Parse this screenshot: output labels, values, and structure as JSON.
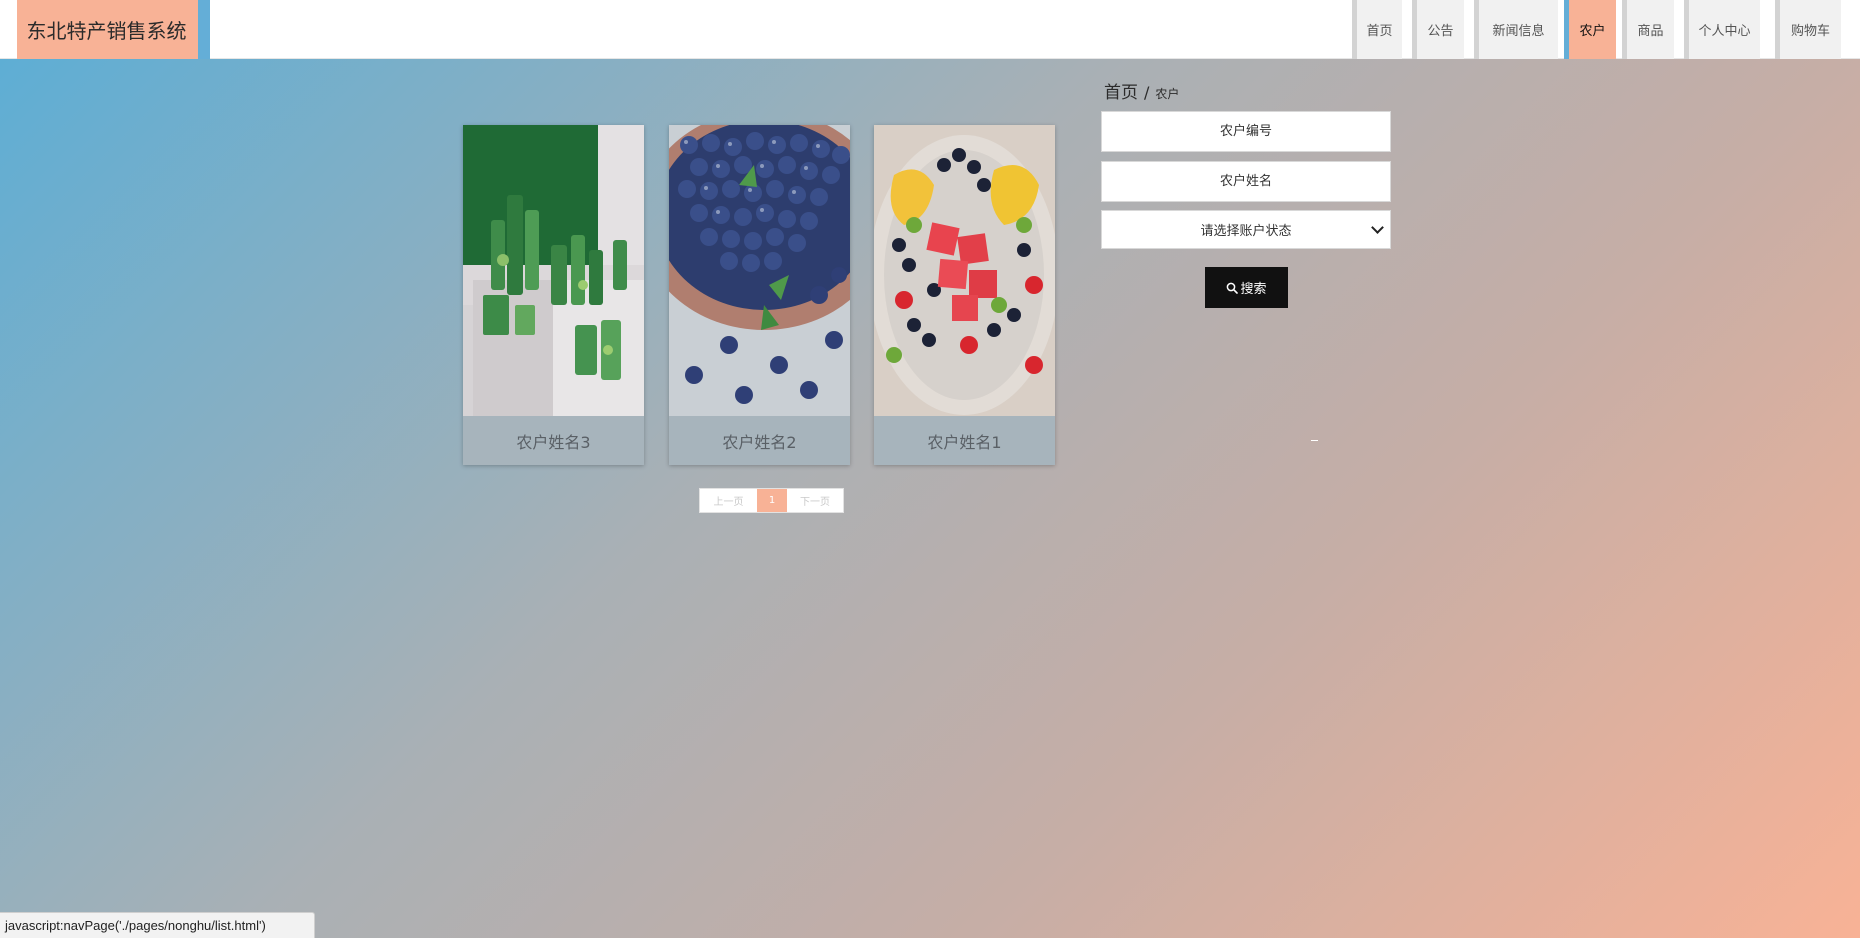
{
  "header": {
    "logo": "东北特产销售系统",
    "nav": [
      {
        "label": "首页",
        "active": false
      },
      {
        "label": "公告",
        "active": false
      },
      {
        "label": "新闻信息",
        "active": false
      },
      {
        "label": "农户",
        "active": true
      },
      {
        "label": "商品",
        "active": false
      },
      {
        "label": "个人中心",
        "active": false
      },
      {
        "label": "购物车",
        "active": false
      }
    ]
  },
  "breadcrumb": {
    "home": "首页",
    "separator": "/",
    "current": "农户"
  },
  "search": {
    "farmer_id_placeholder": "农户编号",
    "farmer_name_placeholder": "农户姓名",
    "status_select": "请选择账户状态",
    "button_label": "搜索"
  },
  "cards": [
    {
      "name": "农户姓名3",
      "image": "green-cosmetic-products"
    },
    {
      "name": "农户姓名2",
      "image": "blueberries"
    },
    {
      "name": "农户姓名1",
      "image": "fruit-platter"
    }
  ],
  "pagination": {
    "prev": "上一页",
    "current": "1",
    "next": "下一页"
  },
  "statusbar": {
    "url": "javascript:navPage('./pages/nonghu/list.html')"
  },
  "colors": {
    "accent": "#f8b296",
    "brand_blue": "#64aed7",
    "button_dark": "#111111"
  }
}
